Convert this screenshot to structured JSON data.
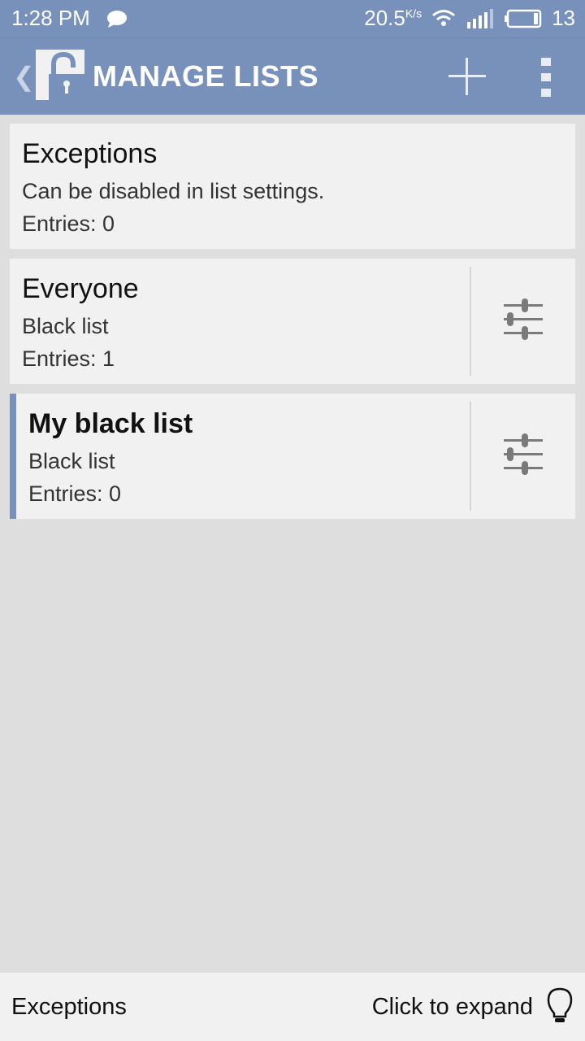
{
  "status_bar": {
    "time": "1:28 PM",
    "notification_icon": "chat-bubble-icon",
    "net_speed": "20.5",
    "net_speed_unit": "K/s",
    "battery_level": "13"
  },
  "app_bar": {
    "title": "MANAGE LISTS",
    "back_icon": "chevron-left-icon",
    "logo_icon": "unlocked-padlock-icon",
    "actions": [
      "add-icon",
      "more-vert-icon"
    ]
  },
  "lists": [
    {
      "name": "Exceptions",
      "subtitle": "Can be disabled in list settings.",
      "entries": "Entries: 0",
      "has_settings": false,
      "selected": false
    },
    {
      "name": "Everyone",
      "subtitle": "Black list",
      "entries": "Entries: 1",
      "has_settings": true,
      "selected": false
    },
    {
      "name": "My black list",
      "subtitle": "Black list",
      "entries": "Entries: 0",
      "has_settings": true,
      "selected": true
    }
  ],
  "footer": {
    "label": "Exceptions",
    "hint": "Click to expand",
    "hint_icon": "lightbulb-icon"
  },
  "colors": {
    "accent": "#7891bb",
    "background": "#dedede",
    "card": "#f1f1f1"
  }
}
